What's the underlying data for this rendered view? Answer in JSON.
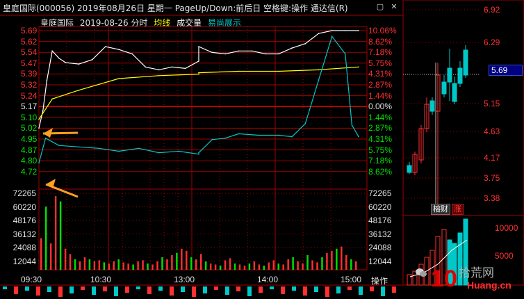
{
  "titlebar": {
    "text": "皇庭国际(000056)  2019年08月26日  星期一  PageUp/Down:前后日  空格键:操作  通达信(R)",
    "close_icon": "close-icon"
  },
  "subtitle": {
    "name": "皇庭国际",
    "date": "2019-08-26 分时",
    "avg": "均线",
    "vol": "成交量",
    "easy": "易尚展示"
  },
  "price_axis": {
    "prices": [
      "5.69",
      "5.62",
      "5.54",
      "5.47",
      "5.39",
      "5.32",
      "5.24",
      "5.17",
      "5.10",
      "5.02",
      "4.95",
      "4.87",
      "4.80",
      "4.72"
    ],
    "pcts": [
      "10.06%",
      "8.62%",
      "7.18%",
      "5.75%",
      "4.31%",
      "2.87%",
      "1.44%",
      "0.00%",
      "1.44%",
      "2.87%",
      "4.31%",
      "5.75%",
      "7.18%",
      "8.62%"
    ]
  },
  "volume_axis": [
    "72265",
    "60220",
    "48176",
    "36132",
    "24088",
    "12044"
  ],
  "time_axis": [
    "09:30",
    "10:30",
    "13:00",
    "14:00",
    "15:00"
  ],
  "op_tab": "操作",
  "kline_axis": [
    "6.92",
    "6.29",
    "5.15",
    "4.63",
    "4.17",
    "3.75",
    "3.38"
  ],
  "kline_vol_axis": [
    "10000",
    "5000"
  ],
  "current_price": "5.69",
  "badges": {
    "fin": "榕财",
    "up": "涨"
  },
  "watermark": {
    "site": "拾荒网",
    "url": "Huang.cn",
    "logo": "10"
  },
  "colors": {
    "up": "#ff3030",
    "down": "#00e000",
    "avg": "#ffff00",
    "stock": "#ffffff",
    "index": "#00c8c8",
    "grid": "#a00000",
    "arrow": "#ffa020"
  },
  "chart_data": {
    "type": "line",
    "title": "皇庭国际 2019-08-26 分时",
    "prev_close": 5.17,
    "ylim": [
      4.72,
      5.69
    ],
    "series": [
      {
        "name": "皇庭国际",
        "x": [
          "09:30",
          "09:33",
          "09:36",
          "09:40",
          "09:45",
          "09:50",
          "10:00",
          "10:10",
          "10:20",
          "10:30",
          "10:40",
          "10:50",
          "11:00",
          "11:10",
          "11:20",
          "11:30",
          "13:00",
          "13:10",
          "13:20",
          "13:30",
          "13:40",
          "13:50",
          "14:00",
          "14:10",
          "14:20",
          "14:30",
          "14:40",
          "14:50",
          "15:00"
        ],
        "y": [
          5.02,
          5.14,
          5.35,
          5.55,
          5.5,
          5.47,
          5.46,
          5.49,
          5.58,
          5.56,
          5.53,
          5.44,
          5.42,
          5.44,
          5.43,
          5.48,
          5.58,
          5.54,
          5.53,
          5.55,
          5.55,
          5.53,
          5.53,
          5.57,
          5.6,
          5.67,
          5.69,
          5.69,
          5.69
        ]
      },
      {
        "name": "均线",
        "x": [
          "09:30",
          "09:40",
          "10:00",
          "10:30",
          "11:00",
          "11:30",
          "13:00",
          "13:30",
          "14:00",
          "14:30",
          "15:00"
        ],
        "y": [
          5.08,
          5.22,
          5.28,
          5.36,
          5.38,
          5.39,
          5.4,
          5.41,
          5.41,
          5.42,
          5.44
        ]
      },
      {
        "name": "易尚展示",
        "x": [
          "09:30",
          "09:35",
          "09:45",
          "10:00",
          "10:15",
          "10:30",
          "10:45",
          "11:00",
          "11:15",
          "11:30",
          "13:00",
          "13:10",
          "13:20",
          "13:30",
          "13:45",
          "14:00",
          "14:10",
          "14:20",
          "14:30",
          "14:40",
          "14:50",
          "14:55",
          "15:00"
        ],
        "y": [
          4.78,
          4.95,
          4.9,
          4.89,
          4.88,
          4.86,
          4.88,
          4.85,
          4.86,
          4.84,
          4.85,
          4.94,
          4.95,
          4.98,
          4.97,
          4.97,
          4.96,
          5.05,
          5.35,
          5.65,
          5.53,
          5.04,
          4.96
        ]
      }
    ],
    "volume": [
      30,
      60,
      25,
      70,
      65,
      20,
      15,
      10,
      8,
      12,
      10,
      8,
      9,
      7,
      6,
      8,
      10,
      7,
      6,
      5,
      8,
      9,
      6,
      5,
      8,
      12,
      10,
      14,
      16,
      20,
      18,
      12,
      10,
      15,
      8,
      6,
      5,
      4,
      9,
      11,
      6,
      5,
      4,
      6,
      8,
      5,
      4,
      7,
      9,
      6,
      5,
      10,
      12,
      8,
      6,
      14,
      9,
      7,
      12,
      16,
      18,
      20,
      22,
      14,
      10,
      8
    ]
  }
}
